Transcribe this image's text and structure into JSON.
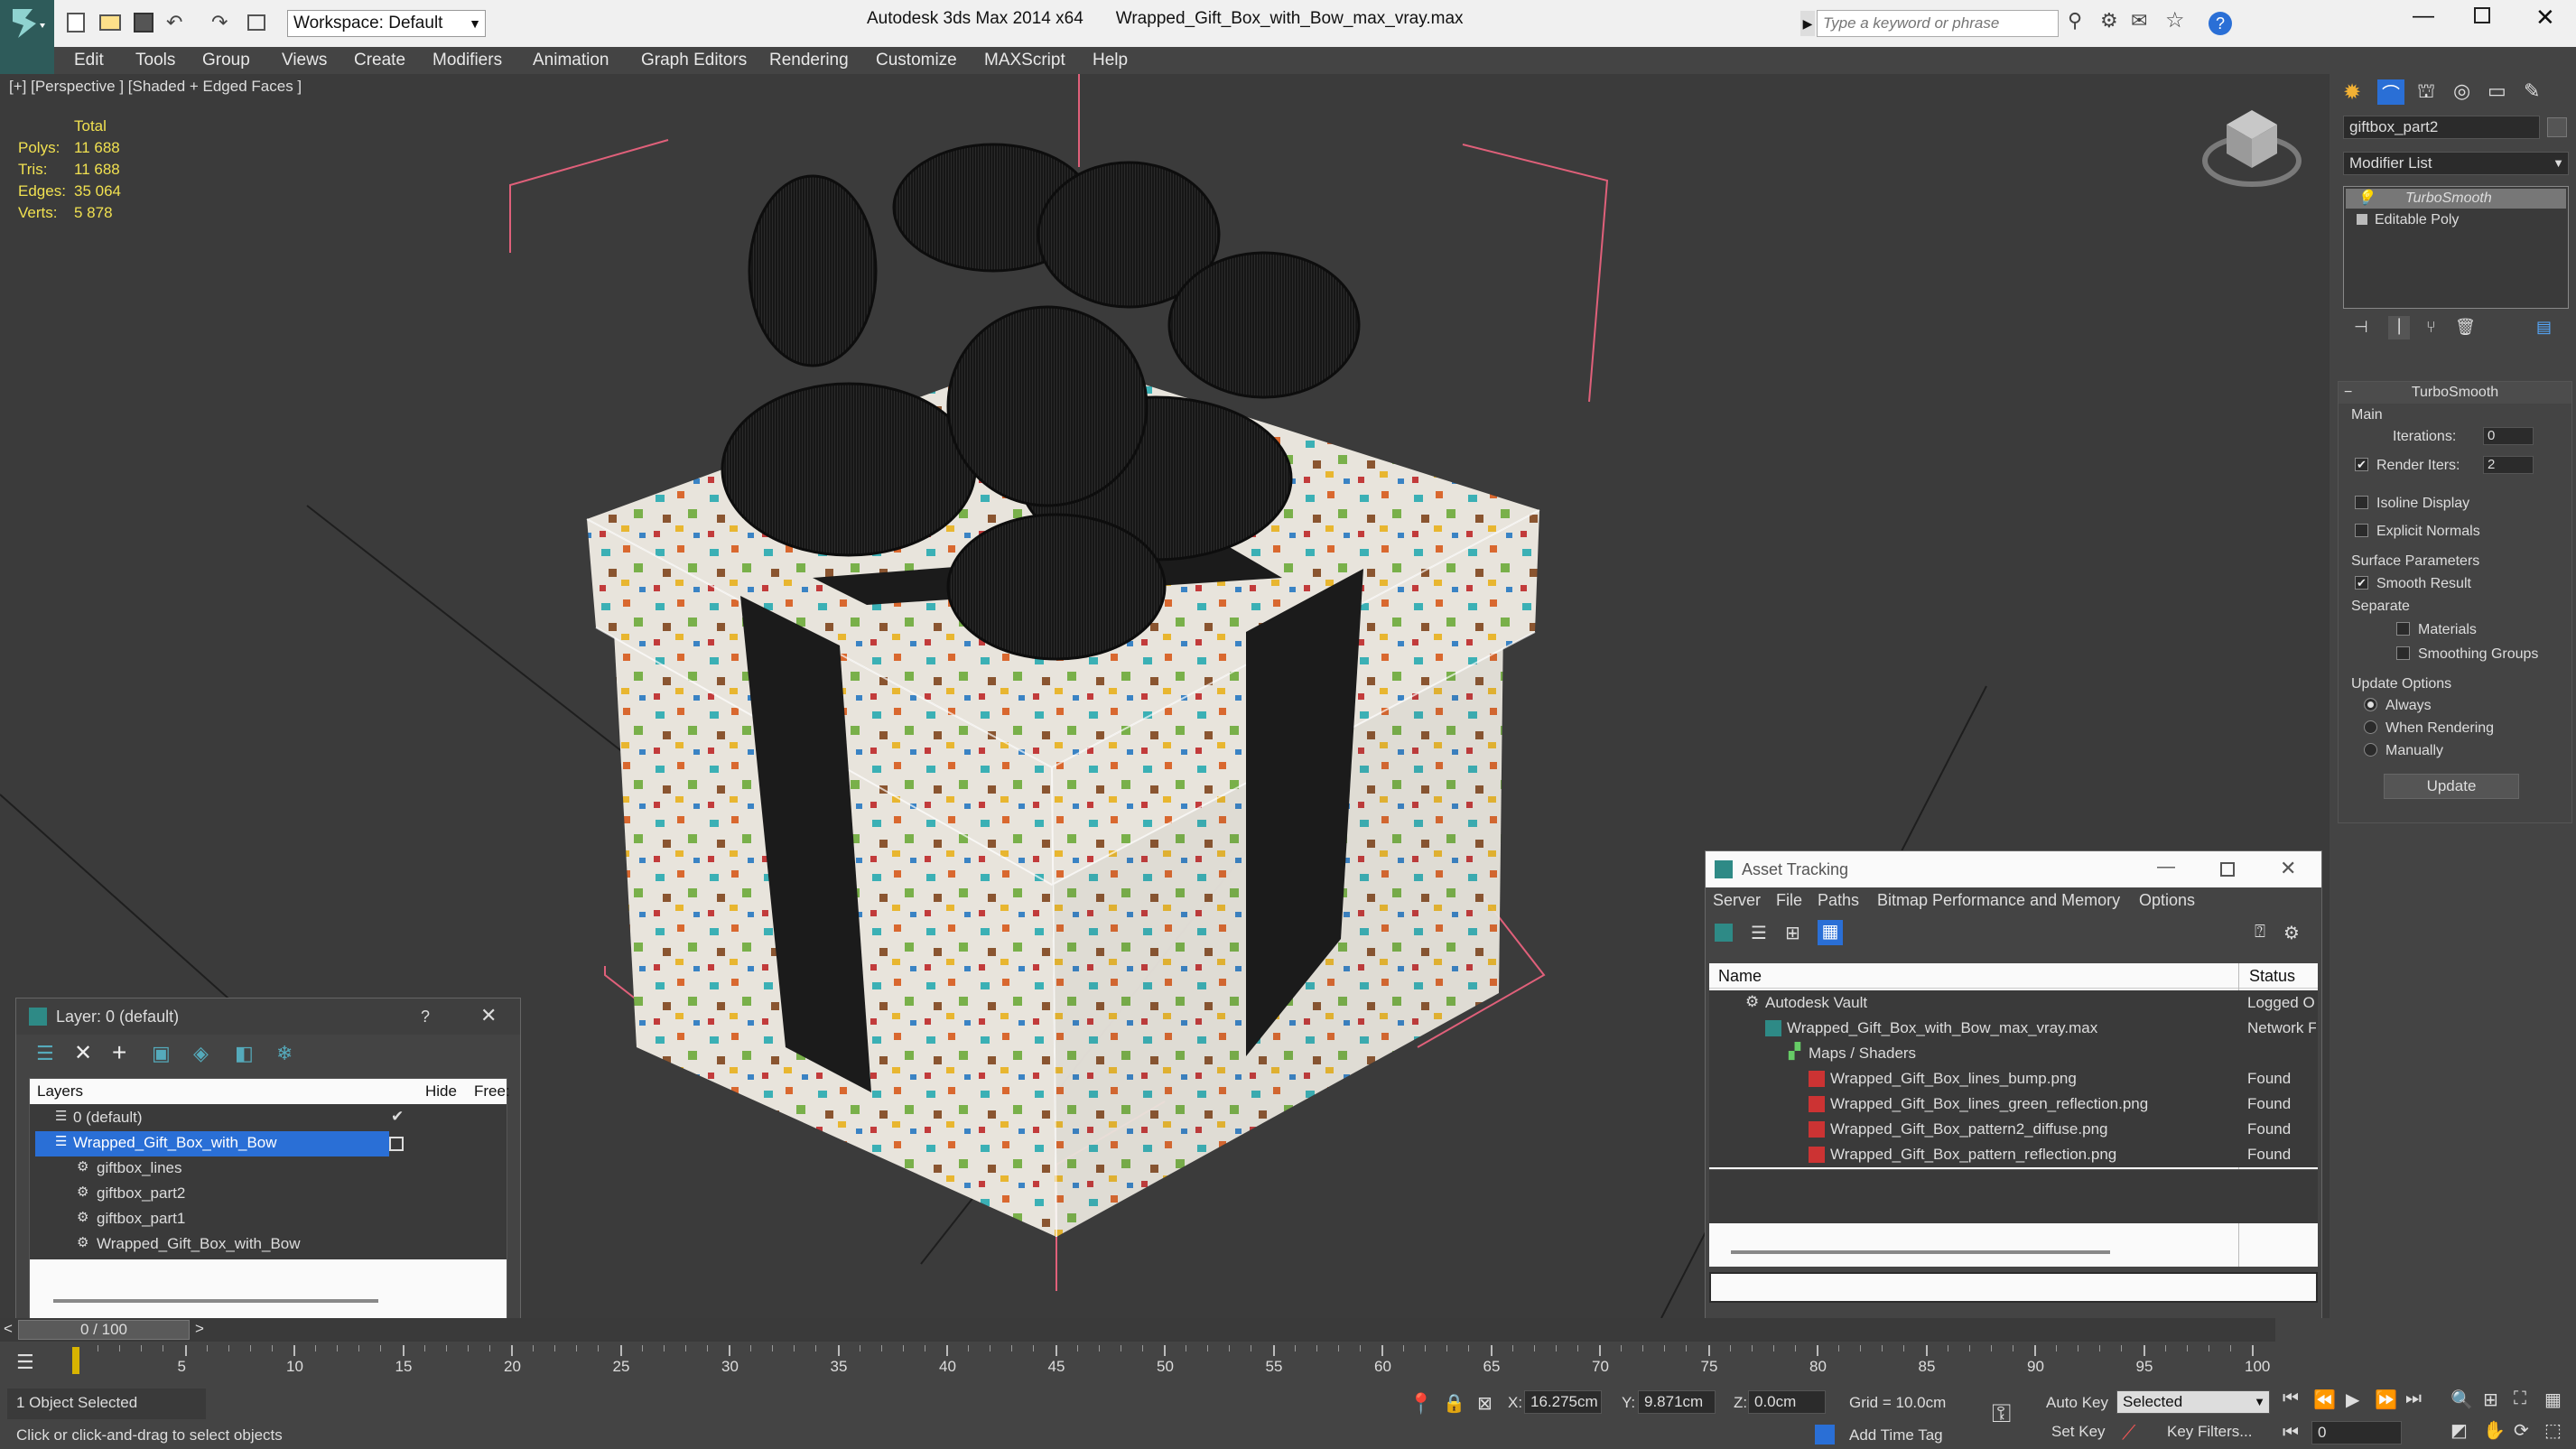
{
  "titlebar": {
    "app": "Autodesk 3ds Max  2014 x64",
    "file": "Wrapped_Gift_Box_with_Bow_max_vray.max",
    "workspace": "Workspace: Default",
    "search_placeholder": "Type a keyword or phrase"
  },
  "menu": [
    "Edit",
    "Tools",
    "Group",
    "Views",
    "Create",
    "Modifiers",
    "Animation",
    "Graph Editors",
    "Rendering",
    "Customize",
    "MAXScript",
    "Help"
  ],
  "viewport": {
    "label": "[+] [Perspective ] [Shaded + Edged Faces ]",
    "stats": {
      "header": "Total",
      "rows": [
        {
          "k": "Polys:",
          "v": "11 688"
        },
        {
          "k": "Tris:",
          "v": "11 688"
        },
        {
          "k": "Edges:",
          "v": "35 064"
        },
        {
          "k": "Verts:",
          "v": "5 878"
        }
      ]
    }
  },
  "command_panel": {
    "object_name": "giftbox_part2",
    "modifier_list": "Modifier List",
    "stack": [
      "TurboSmooth",
      "Editable Poly"
    ],
    "rollout": "TurboSmooth",
    "main": "Main",
    "iterations_label": "Iterations:",
    "iterations": "0",
    "render_iters_label": "Render Iters:",
    "render_iters": "2",
    "isoline": "Isoline Display",
    "explicit": "Explicit Normals",
    "surface": "Surface Parameters",
    "smooth_result": "Smooth Result",
    "separate": "Separate",
    "materials": "Materials",
    "smoothing_groups": "Smoothing Groups",
    "update_options": "Update Options",
    "always": "Always",
    "when_rendering": "When Rendering",
    "manually": "Manually",
    "update": "Update"
  },
  "layer_window": {
    "title": "Layer: 0 (default)",
    "help": "?",
    "col_layers": "Layers",
    "col_hide": "Hide",
    "col_freeze": "Free:",
    "rows": [
      "0 (default)",
      "Wrapped_Gift_Box_with_Bow",
      "giftbox_lines",
      "giftbox_part2",
      "giftbox_part1",
      "Wrapped_Gift_Box_with_Bow"
    ]
  },
  "asset_window": {
    "title": "Asset Tracking",
    "menu": [
      "Server",
      "File",
      "Paths",
      "Bitmap Performance and Memory",
      "Options"
    ],
    "col_name": "Name",
    "col_status": "Status",
    "rows": [
      {
        "name": "Autodesk Vault",
        "status": "Logged O"
      },
      {
        "name": "Wrapped_Gift_Box_with_Bow_max_vray.max",
        "status": "Network F"
      },
      {
        "name": "Maps / Shaders",
        "status": ""
      },
      {
        "name": "Wrapped_Gift_Box_lines_bump.png",
        "status": "Found"
      },
      {
        "name": "Wrapped_Gift_Box_lines_green_reflection.png",
        "status": "Found"
      },
      {
        "name": "Wrapped_Gift_Box_pattern2_diffuse.png",
        "status": "Found"
      },
      {
        "name": "Wrapped_Gift_Box_pattern_reflection.png",
        "status": "Found"
      }
    ]
  },
  "timeline": {
    "frame": "0 / 100",
    "ticks": [
      "5",
      "10",
      "15",
      "20",
      "25",
      "30",
      "35",
      "40",
      "45",
      "50",
      "55",
      "60",
      "65",
      "70",
      "75",
      "80",
      "85",
      "90",
      "95",
      "100"
    ]
  },
  "status": {
    "selected": "1 Object Selected",
    "prompt": "Click or click-and-drag to select objects",
    "x_label": "X:",
    "x": "16.275cm",
    "y_label": "Y:",
    "y": "9.871cm",
    "z_label": "Z:",
    "z": "0.0cm",
    "grid": "Grid = 10.0cm",
    "add_time_tag": "Add Time Tag",
    "auto_key": "Auto Key",
    "set_key": "Set Key",
    "selected_dd": "Selected",
    "key_filters": "Key Filters...",
    "frame_field": "0"
  },
  "colors": {
    "accent": "#2a6fd6",
    "viewport": "#3b3b3b",
    "panel": "#444444",
    "stats": "#f0e050"
  }
}
